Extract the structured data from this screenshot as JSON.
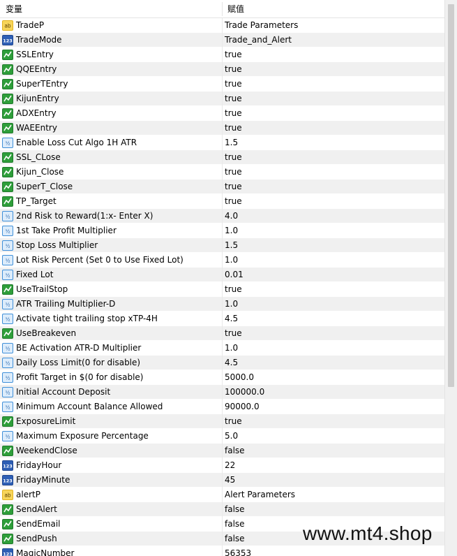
{
  "header": {
    "col_variable": "变量",
    "col_value": "赋值"
  },
  "rows": [
    {
      "icon": "ab-icon",
      "name": "TradeP",
      "value": "Trade Parameters"
    },
    {
      "icon": "123-icon",
      "name": "TradeMode",
      "value": "Trade_and_Alert"
    },
    {
      "icon": "bool-icon",
      "name": "SSLEntry",
      "value": "true"
    },
    {
      "icon": "bool-icon",
      "name": "QQEEntry",
      "value": "true"
    },
    {
      "icon": "bool-icon",
      "name": "SuperTEntry",
      "value": "true"
    },
    {
      "icon": "bool-icon",
      "name": "KijunEntry",
      "value": "true"
    },
    {
      "icon": "bool-icon",
      "name": "ADXEntry",
      "value": "true"
    },
    {
      "icon": "bool-icon",
      "name": "WAEEntry",
      "value": "true"
    },
    {
      "icon": "double-icon",
      "name": "Enable Loss Cut Algo 1H ATR",
      "value": "1.5"
    },
    {
      "icon": "bool-icon",
      "name": "SSL_CLose",
      "value": "true"
    },
    {
      "icon": "bool-icon",
      "name": "Kijun_Close",
      "value": "true"
    },
    {
      "icon": "bool-icon",
      "name": "SuperT_Close",
      "value": "true"
    },
    {
      "icon": "bool-icon",
      "name": "TP_Target",
      "value": "true"
    },
    {
      "icon": "double-icon",
      "name": "2nd Risk to Reward(1:x- Enter X)",
      "value": "4.0"
    },
    {
      "icon": "double-icon",
      "name": "1st Take Profit Multiplier",
      "value": "1.0"
    },
    {
      "icon": "double-icon",
      "name": "Stop Loss Multiplier",
      "value": "1.5"
    },
    {
      "icon": "double-icon",
      "name": "Lot Risk Percent (Set 0 to Use Fixed Lot)",
      "value": "1.0"
    },
    {
      "icon": "double-icon",
      "name": "Fixed Lot",
      "value": "0.01"
    },
    {
      "icon": "bool-icon",
      "name": "UseTrailStop",
      "value": "true"
    },
    {
      "icon": "double-icon",
      "name": "ATR Trailing Multiplier-D",
      "value": "1.0"
    },
    {
      "icon": "double-icon",
      "name": "Activate tight trailing stop xTP-4H",
      "value": "4.5"
    },
    {
      "icon": "bool-icon",
      "name": "UseBreakeven",
      "value": "true"
    },
    {
      "icon": "double-icon",
      "name": "BE Activation ATR-D Multiplier",
      "value": "1.0"
    },
    {
      "icon": "double-icon",
      "name": "Daily Loss Limit(0 for disable)",
      "value": "4.5"
    },
    {
      "icon": "double-icon",
      "name": "Profit Target in $(0 for disable)",
      "value": "5000.0"
    },
    {
      "icon": "double-icon",
      "name": "Initial Account Deposit",
      "value": "100000.0"
    },
    {
      "icon": "double-icon",
      "name": "Minimum Account Balance Allowed",
      "value": "90000.0"
    },
    {
      "icon": "bool-icon",
      "name": "ExposureLimit",
      "value": "true"
    },
    {
      "icon": "double-icon",
      "name": "Maximum Exposure Percentage",
      "value": "5.0"
    },
    {
      "icon": "bool-icon",
      "name": "WeekendClose",
      "value": "false"
    },
    {
      "icon": "123-icon",
      "name": "FridayHour",
      "value": "22"
    },
    {
      "icon": "123-icon",
      "name": "FridayMinute",
      "value": "45"
    },
    {
      "icon": "ab-icon",
      "name": "alertP",
      "value": "Alert Parameters"
    },
    {
      "icon": "bool-icon",
      "name": "SendAlert",
      "value": "false"
    },
    {
      "icon": "bool-icon",
      "name": "SendEmail",
      "value": "false"
    },
    {
      "icon": "bool-icon",
      "name": "SendPush",
      "value": "false"
    },
    {
      "icon": "123-icon",
      "name": "MagicNumber",
      "value": "56353"
    }
  ],
  "watermark": "www.mt4.shop",
  "colors": {
    "alt_row": "#f0f0f0",
    "bool_icon": "#2e9e3a",
    "int_icon": "#2e5fb5",
    "double_icon": "#3f8fd8",
    "string_icon": "#e2b21e"
  }
}
